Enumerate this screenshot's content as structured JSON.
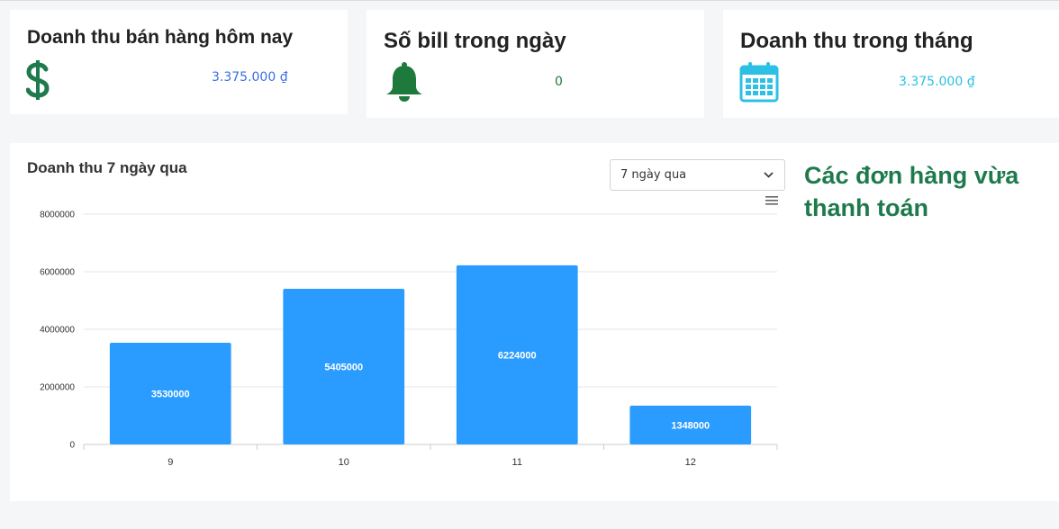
{
  "cards": {
    "today_revenue": {
      "title": "Doanh thu bán hàng hôm nay",
      "value": "3.375.000 ₫",
      "icon": "dollar-icon",
      "color": "#1e7a4c"
    },
    "bills_today": {
      "title": "Số bill trong ngày",
      "value": "0",
      "icon": "bell-icon",
      "color": "#1e7a3c"
    },
    "month_revenue": {
      "title": "Doanh thu trong tháng",
      "value": "3.375.000 ₫",
      "icon": "calendar-icon",
      "color": "#2bc0e4"
    }
  },
  "revenue_chart": {
    "title": "Doanh thu 7 ngày qua",
    "range_select": {
      "selected": "7 ngày qua"
    },
    "menu_icon": "hamburger-menu-icon"
  },
  "recent_orders": {
    "title": "Các đơn hàng vừa thanh toán"
  },
  "chart_data": {
    "type": "bar",
    "categories": [
      "9",
      "10",
      "11",
      "12"
    ],
    "values": [
      3530000,
      5405000,
      6224000,
      1348000
    ],
    "ylim": [
      0,
      8000000
    ],
    "yticks": [
      0,
      2000000,
      4000000,
      6000000,
      8000000
    ],
    "grid": true,
    "bar_color": "#2b9cff",
    "data_labels": true
  }
}
